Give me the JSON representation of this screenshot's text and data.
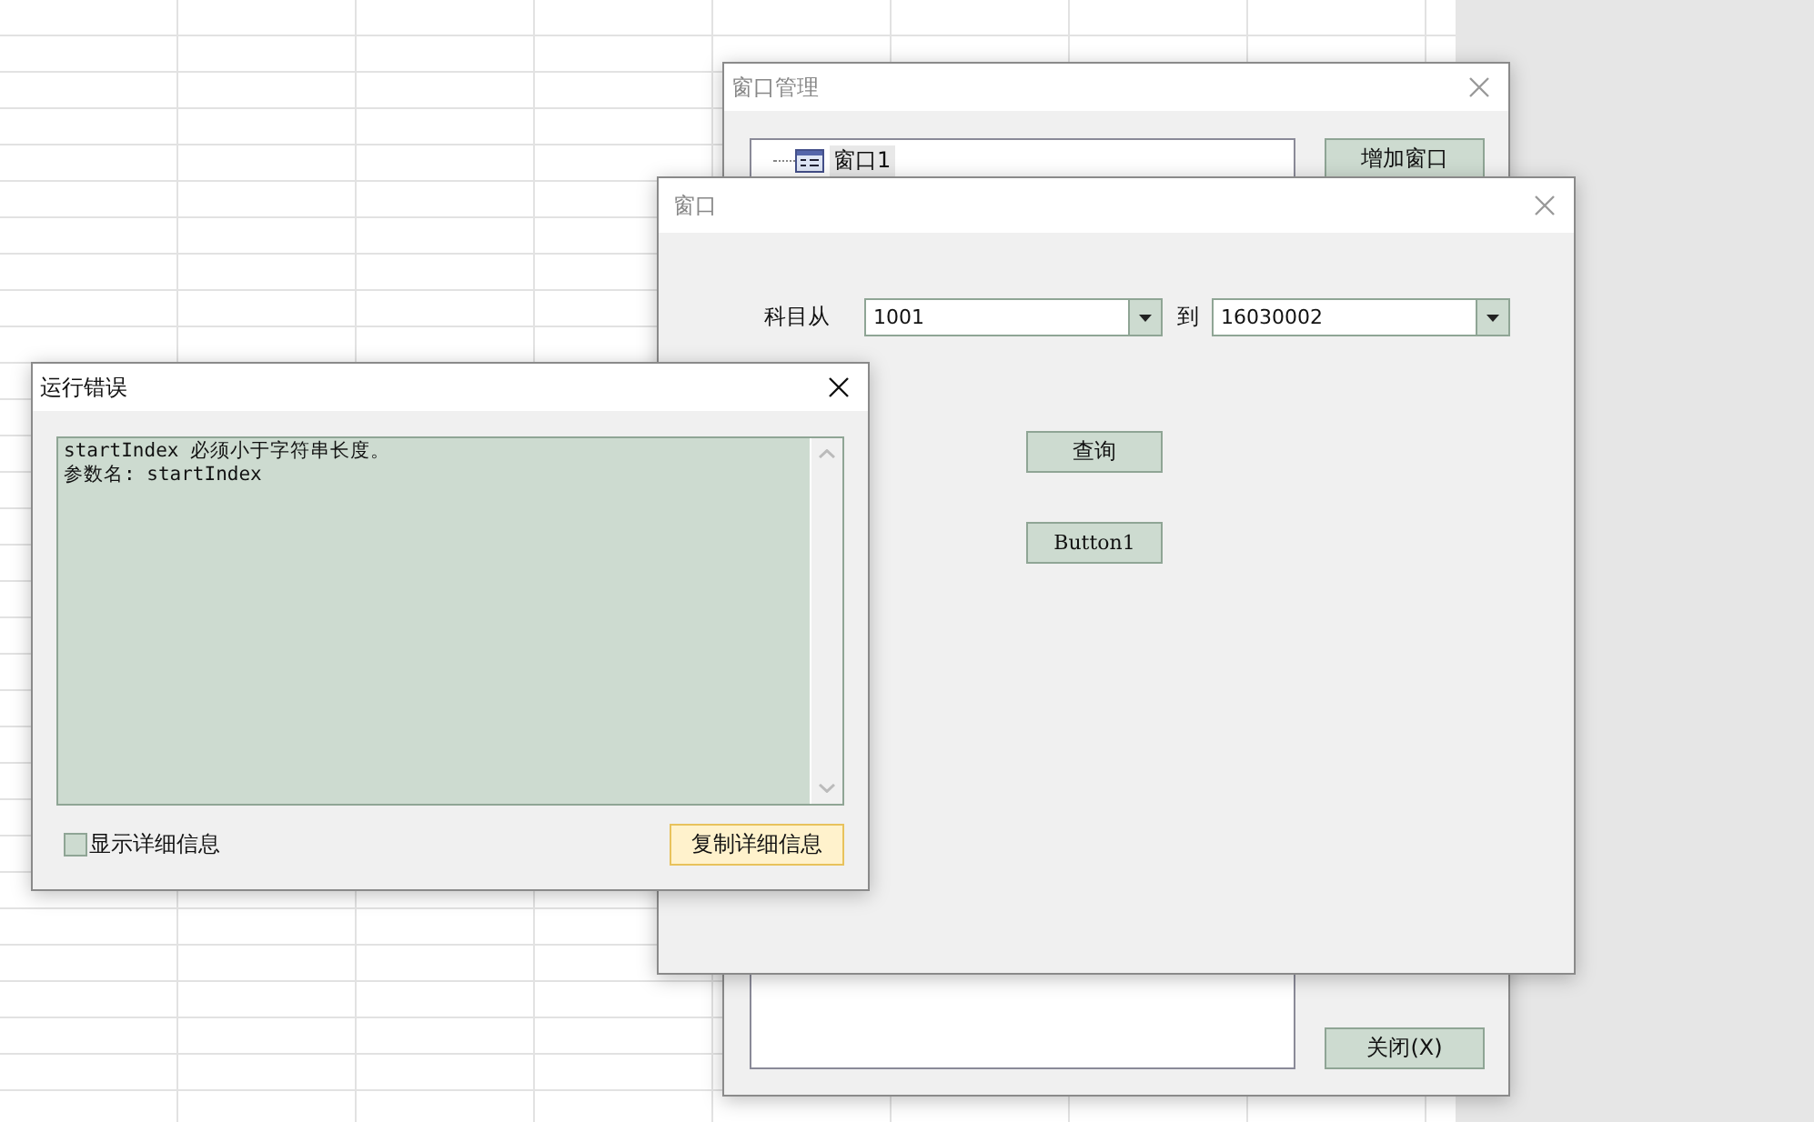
{
  "window_manager": {
    "title": "窗口管理",
    "tree": [
      {
        "label": "窗口1",
        "selected": true
      }
    ],
    "add_button": "增加窗口",
    "close_button": "关闭(X)"
  },
  "form_window": {
    "title": "窗口",
    "from_label": "科目从",
    "from_value": "1001",
    "to_label": "到",
    "to_value": "16030002",
    "query_button": "查询",
    "button1": "Button1"
  },
  "error_dialog": {
    "title": "运行错误",
    "message_lines": [
      "startIndex 必须小于字符串长度。",
      "参数名: startIndex"
    ],
    "show_details": {
      "label": "显示详细信息",
      "checked": false
    },
    "copy_button": "复制详细信息"
  }
}
